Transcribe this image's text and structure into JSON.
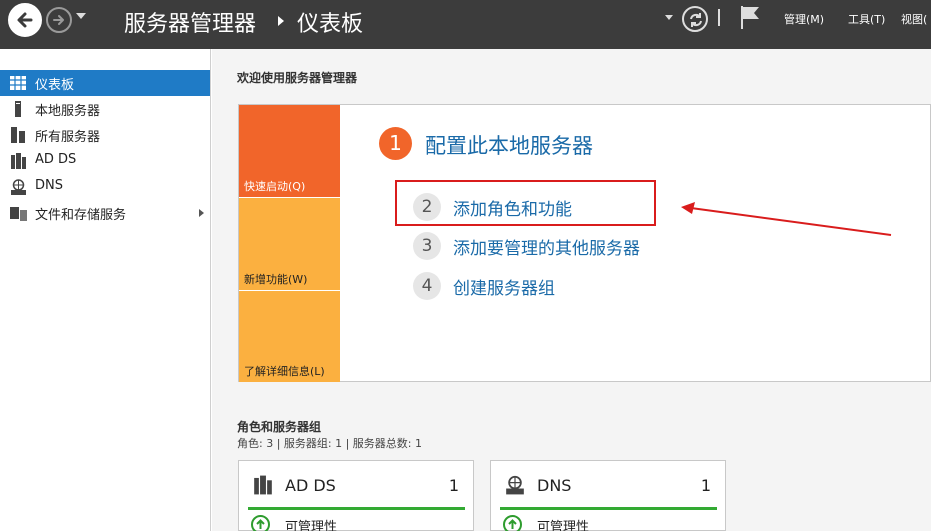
{
  "header": {
    "app_title": "服务器管理器",
    "page_title": "仪表板",
    "menus": [
      "管理(M)",
      "工具(T)",
      "视图("
    ]
  },
  "sidebar": {
    "items": [
      {
        "label": "仪表板",
        "icon": "dashboard-icon",
        "active": true
      },
      {
        "label": "本地服务器",
        "icon": "server-icon"
      },
      {
        "label": "所有服务器",
        "icon": "servers-icon"
      },
      {
        "label": "AD DS",
        "icon": "ad-ds-icon"
      },
      {
        "label": "DNS",
        "icon": "dns-icon"
      },
      {
        "label": "文件和存储服务",
        "icon": "storage-icon",
        "has_submenu": true
      }
    ]
  },
  "main": {
    "welcome": "欢迎使用服务器管理器",
    "quickstart": {
      "tiles": [
        "快速启动(Q)",
        "新增功能(W)",
        "了解详细信息(L)"
      ],
      "step1": {
        "num": "1",
        "label": "配置此本地服务器"
      },
      "steps": [
        {
          "num": "2",
          "label": "添加角色和功能"
        },
        {
          "num": "3",
          "label": "添加要管理的其他服务器"
        },
        {
          "num": "4",
          "label": "创建服务器组"
        }
      ]
    },
    "roles": {
      "title": "角色和服务器组",
      "subtitle": "角色: 3 | 服务器组: 1 | 服务器总数: 1",
      "cards": [
        {
          "name": "AD DS",
          "count": "1",
          "status": "可管理性",
          "icon": "ad-ds-icon"
        },
        {
          "name": "DNS",
          "count": "1",
          "status": "可管理性",
          "icon": "dns-icon"
        }
      ]
    }
  },
  "colors": {
    "titlebar": "#3c3c3c",
    "accent": "#1f7bc6",
    "orange": "#f1652a",
    "amber": "#fbb040",
    "link": "#1a6aa8",
    "annotation": "#d91c1c",
    "ok_green": "#33aa33"
  }
}
